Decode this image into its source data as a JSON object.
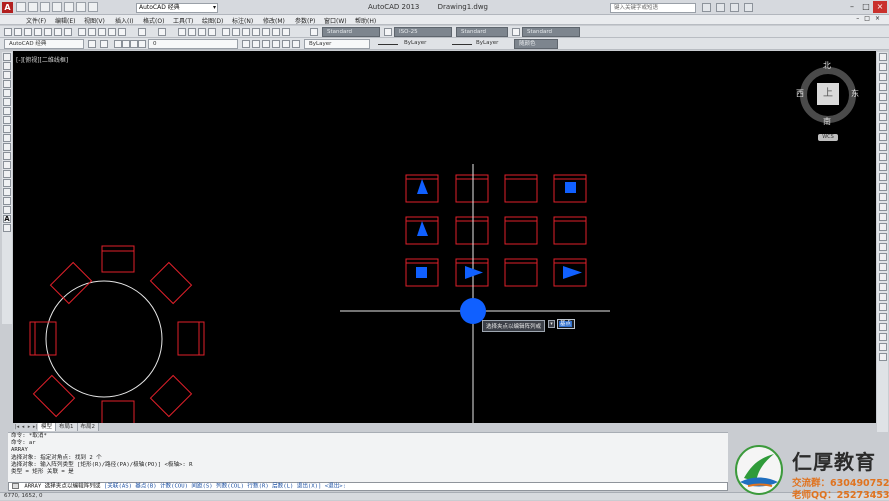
{
  "window": {
    "app_title": "AutoCAD 2013",
    "file_name": "Drawing1.dwg",
    "workspace": "AutoCAD 经典",
    "search_placeholder": "键入关键字或短语"
  },
  "menu": [
    "文件(F)",
    "编辑(E)",
    "视图(V)",
    "插入(I)",
    "格式(O)",
    "工具(T)",
    "绘图(D)",
    "标注(N)",
    "修改(M)",
    "参数(P)",
    "窗口(W)",
    "帮助(H)"
  ],
  "toolbar": {
    "text_style": "Standard",
    "dim_style": "ISO-25",
    "table_style": "Standard",
    "multileader_style": "Standard",
    "workspace_combo": "AutoCAD 经典",
    "layer_current": "0",
    "color_control": "ByLayer",
    "linetype_control": "ByLayer",
    "lineweight_control": "ByLayer",
    "plotstyle_control": "随颜色"
  },
  "viewport": {
    "label": "[-][俯视][二维线框]",
    "viewcube": {
      "north": "北",
      "south": "南",
      "east": "东",
      "west": "西",
      "top": "上",
      "wcs": "WCS"
    }
  },
  "grip_tooltip": {
    "text": "选择夹点以编辑阵列或",
    "dropdown": "▾",
    "input_value": "基点"
  },
  "layout_tabs": [
    "模型",
    "布局1",
    "布局2"
  ],
  "command_history": [
    "命令: *取消*",
    "命令: ar",
    "ARRAY",
    "选择对象: 指定对角点: 找到 2 个",
    "选择对象:  输入阵列类型 [矩形(R)/路径(PA)/极轴(PO)] <极轴>: R",
    "类型 = 矩形  关联 = 是"
  ],
  "command_line": {
    "prompt": "ARRAY 选择夹点以编辑阵列或",
    "options": "[关联(AS) 基点(B) 计数(COU) 间距(S) 列数(COL) 行数(R) 层数(L) 退出(X)] <退出>:"
  },
  "status": {
    "coordinates": "6770, 1652, 0"
  },
  "watermark": {
    "name": "仁厚教育",
    "group": "交流群：630490752",
    "qq": "老师QQ：252734531"
  },
  "colors": {
    "canvas": "#000000",
    "geometry_red": "#e0202a",
    "grip_blue": "#1060ff",
    "accent_orange": "#e0731f"
  }
}
